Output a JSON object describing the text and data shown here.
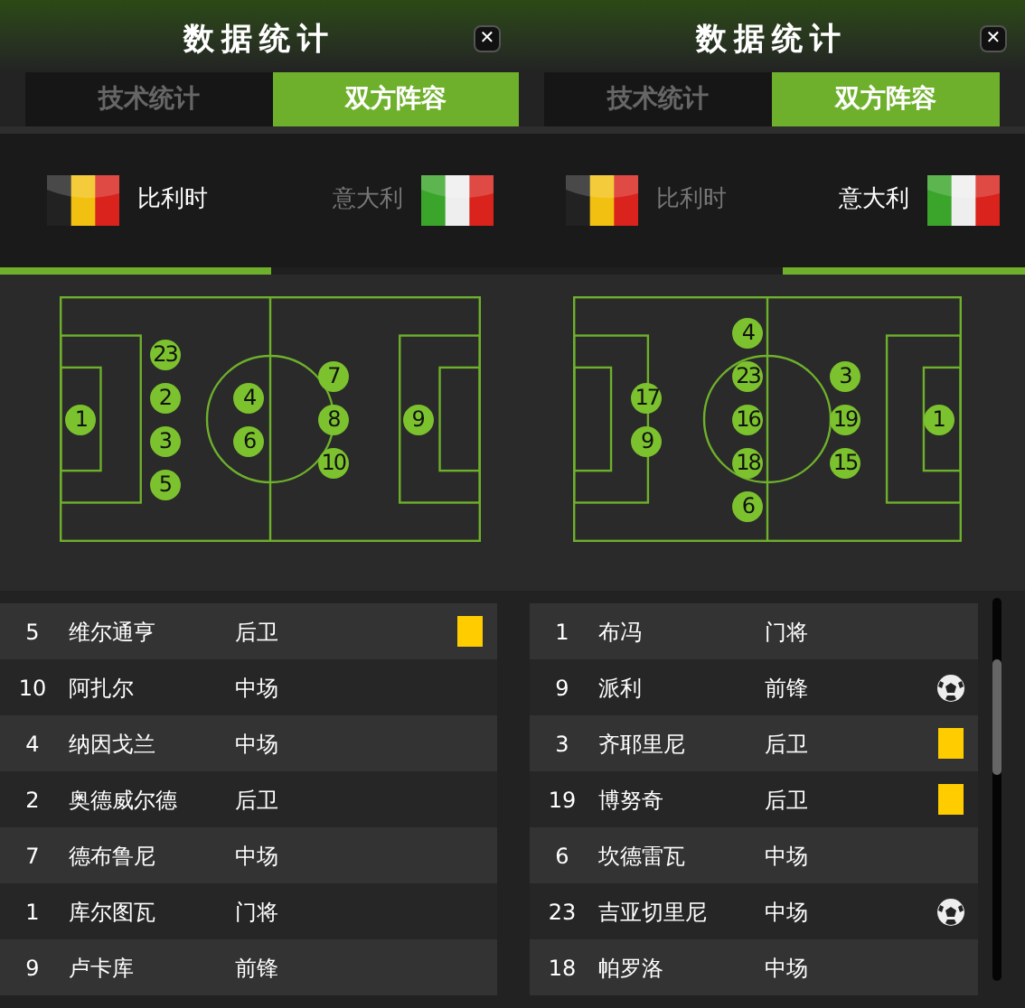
{
  "panels": [
    {
      "title": "数据统计",
      "close": "✕",
      "tabs": [
        {
          "label": "技术统计",
          "selected": false
        },
        {
          "label": "双方阵容",
          "selected": true
        }
      ],
      "teams": [
        {
          "name": "比利时",
          "kind": "belgium",
          "selected": true
        },
        {
          "name": "意大利",
          "kind": "italy",
          "selected": false
        }
      ],
      "formation": [
        [
          "1"
        ],
        [
          "23",
          "2",
          "3",
          "5"
        ],
        [
          "4",
          "6"
        ],
        [
          "7",
          "8",
          "10"
        ],
        [
          "9"
        ]
      ],
      "players": [
        {
          "number": "5",
          "name": "维尔通亨",
          "position": "后卫",
          "kind": "booked"
        },
        {
          "number": "10",
          "name": "阿扎尔",
          "position": "中场",
          "kind": "plain"
        },
        {
          "number": "4",
          "name": "纳因戈兰",
          "position": "中场",
          "kind": "plain"
        },
        {
          "number": "2",
          "name": "奥德威尔德",
          "position": "后卫",
          "kind": "plain"
        },
        {
          "number": "7",
          "name": "德布鲁尼",
          "position": "中场",
          "kind": "plain"
        },
        {
          "number": "1",
          "name": "库尔图瓦",
          "position": "门将",
          "kind": "plain"
        },
        {
          "number": "9",
          "name": "卢卡库",
          "position": "前锋",
          "kind": "plain"
        }
      ]
    },
    {
      "title": "数据统计",
      "close": "✕",
      "tabs": [
        {
          "label": "技术统计",
          "selected": false
        },
        {
          "label": "双方阵容",
          "selected": true
        }
      ],
      "teams": [
        {
          "name": "比利时",
          "kind": "belgium",
          "selected": false
        },
        {
          "name": "意大利",
          "kind": "italy",
          "selected": true
        }
      ],
      "formation": [
        [
          "17",
          "9"
        ],
        [
          "4",
          "23",
          "16",
          "18",
          "6"
        ],
        [
          "3",
          "19",
          "15"
        ],
        [
          "1"
        ]
      ],
      "players": [
        {
          "number": "1",
          "name": "布冯",
          "position": "门将",
          "kind": "plain"
        },
        {
          "number": "9",
          "name": "派利",
          "position": "前锋",
          "kind": "scored"
        },
        {
          "number": "3",
          "name": "齐耶里尼",
          "position": "后卫",
          "kind": "booked"
        },
        {
          "number": "19",
          "name": "博努奇",
          "position": "后卫",
          "kind": "booked"
        },
        {
          "number": "6",
          "name": "坎德雷瓦",
          "position": "中场",
          "kind": "plain"
        },
        {
          "number": "23",
          "name": "吉亚切里尼",
          "position": "中场",
          "kind": "scored"
        },
        {
          "number": "18",
          "name": "帕罗洛",
          "position": "中场",
          "kind": "plain"
        }
      ]
    }
  ]
}
